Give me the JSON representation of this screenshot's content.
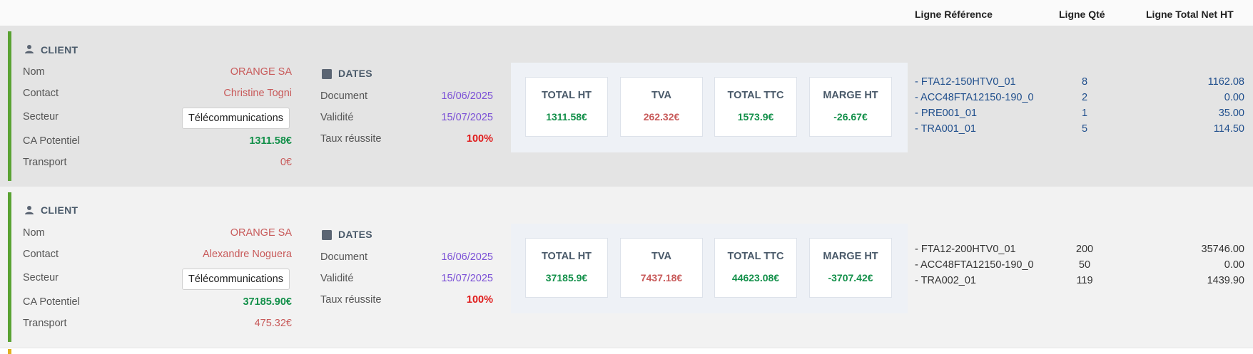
{
  "columns": {
    "ref": "Ligne Référence",
    "qty": "Ligne Qté",
    "total": "Ligne Total Net HT"
  },
  "records": [
    {
      "client_title": "CLIENT",
      "nom_label": "Nom",
      "nom": "ORANGE SA",
      "contact_label": "Contact",
      "contact": "Christine Togni",
      "secteur_label": "Secteur",
      "secteur": "Télécommunications",
      "ca_label": "CA Potentiel",
      "ca": "1311.58€",
      "transport_label": "Transport",
      "transport": "0€",
      "dates_title": "DATES",
      "document_label": "Document",
      "document": "16/06/2025",
      "validite_label": "Validité",
      "validite": "15/07/2025",
      "taux_label": "Taux réussite",
      "taux": "100%",
      "cards": [
        {
          "title": "TOTAL HT",
          "value": "1311.58€"
        },
        {
          "title": "TVA",
          "value": "262.32€"
        },
        {
          "title": "TOTAL TTC",
          "value": "1573.9€"
        },
        {
          "title": "MARGE HT",
          "value": "-26.67€"
        }
      ],
      "lines": [
        {
          "ref": "- FTA12-150HTV0_01",
          "qty": "8",
          "total": "1162.08"
        },
        {
          "ref": "- ACC48FTA12150-190_0",
          "qty": "2",
          "total": "0.00"
        },
        {
          "ref": "- PRE001_01",
          "qty": "1",
          "total": "35.00"
        },
        {
          "ref": "- TRA001_01",
          "qty": "5",
          "total": "114.50"
        }
      ]
    },
    {
      "client_title": "CLIENT",
      "nom_label": "Nom",
      "nom": "ORANGE SA",
      "contact_label": "Contact",
      "contact": "Alexandre Noguera",
      "secteur_label": "Secteur",
      "secteur": "Télécommunications",
      "ca_label": "CA Potentiel",
      "ca": "37185.90€",
      "transport_label": "Transport",
      "transport": "475.32€",
      "dates_title": "DATES",
      "document_label": "Document",
      "document": "16/06/2025",
      "validite_label": "Validité",
      "validite": "15/07/2025",
      "taux_label": "Taux réussite",
      "taux": "100%",
      "cards": [
        {
          "title": "TOTAL HT",
          "value": "37185.9€"
        },
        {
          "title": "TVA",
          "value": "7437.18€"
        },
        {
          "title": "TOTAL TTC",
          "value": "44623.08€"
        },
        {
          "title": "MARGE HT",
          "value": "-3707.42€"
        }
      ],
      "lines": [
        {
          "ref": "- FTA12-200HTV0_01",
          "qty": "200",
          "total": "35746.00"
        },
        {
          "ref": "- ACC48FTA12150-190_0",
          "qty": "50",
          "total": "0.00"
        },
        {
          "ref": "- TRA002_01",
          "qty": "119",
          "total": "1439.90"
        }
      ]
    }
  ]
}
